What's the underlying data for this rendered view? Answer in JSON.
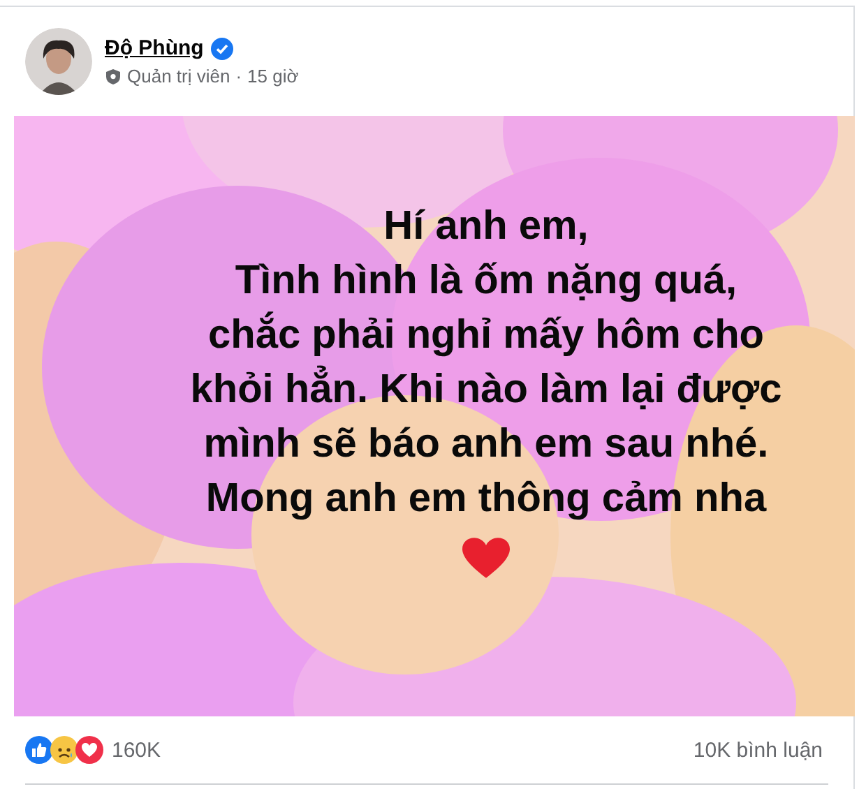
{
  "post": {
    "author": "Độ Phùng",
    "verified": true,
    "role": "Quản trị viên",
    "separator": "·",
    "time": "15 giờ",
    "text_lines": [
      "Hí anh em,",
      "Tình hình là ốm nặng quá,",
      "chắc phải nghỉ mấy hôm cho",
      "khỏi hẳn. Khi nào làm lại được",
      "mình sẽ báo anh em sau nhé.",
      "Mong anh em thông cảm nha"
    ],
    "reaction_count": "160K",
    "comment_count": "10K bình luận"
  }
}
